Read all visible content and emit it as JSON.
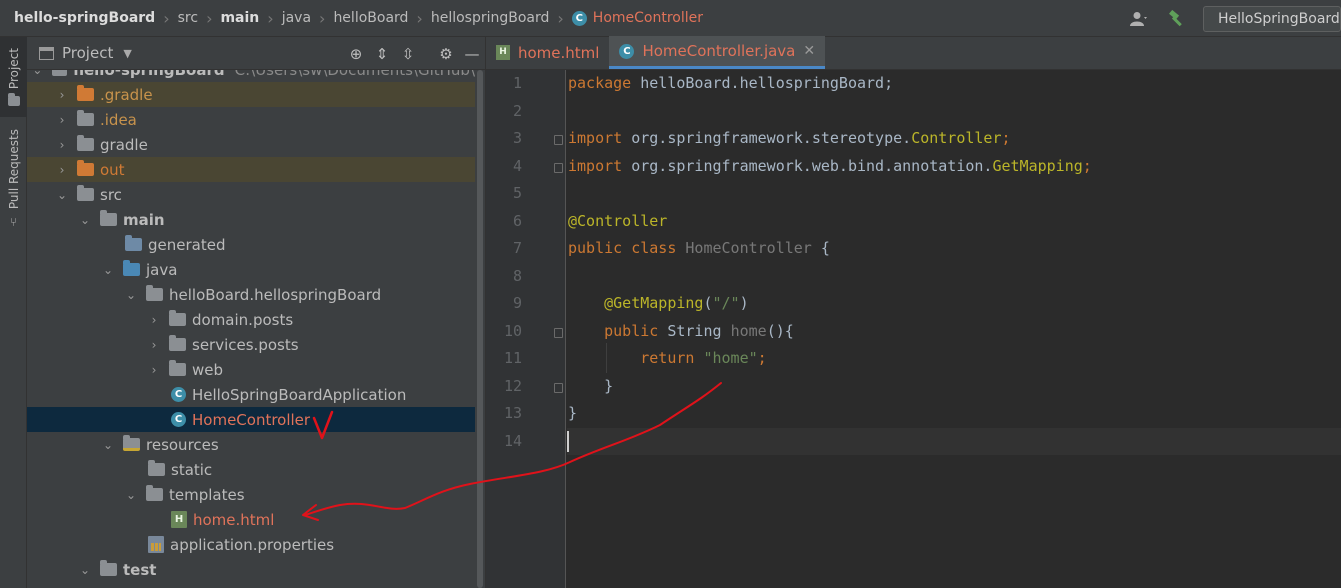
{
  "breadcrumb": [
    "hello-springBoard",
    "src",
    "main",
    "java",
    "helloBoard",
    "hellospringBoard",
    "HomeController"
  ],
  "toolbar": {
    "run_config": "HelloSpringBoardApp",
    "user_icon": "user-icon",
    "build_icon": "hammer-icon"
  },
  "tool_strip": {
    "project_tab": "Project",
    "pull_requests_tab": "Pull Requests"
  },
  "project_panel": {
    "title": "Project",
    "root": {
      "label": "hello-springBoard",
      "path": "C:\\Users\\sw\\Documents\\GitHub\\"
    },
    "tree": [
      {
        "label": ".gradle",
        "kind": "folder-excluded"
      },
      {
        "label": ".idea",
        "kind": "folder"
      },
      {
        "label": "gradle",
        "kind": "folder"
      },
      {
        "label": "out",
        "kind": "folder-excluded"
      },
      {
        "label": "src",
        "kind": "folder"
      },
      {
        "label": "main",
        "kind": "folder"
      },
      {
        "label": "generated",
        "kind": "folder"
      },
      {
        "label": "java",
        "kind": "folder"
      },
      {
        "label": "helloBoard.hellospringBoard",
        "kind": "package"
      },
      {
        "label": "domain.posts",
        "kind": "package"
      },
      {
        "label": "services.posts",
        "kind": "package"
      },
      {
        "label": "web",
        "kind": "package"
      },
      {
        "label": "HelloSpringBoardApplication",
        "kind": "class"
      },
      {
        "label": "HomeController",
        "kind": "class"
      },
      {
        "label": "resources",
        "kind": "folder"
      },
      {
        "label": "static",
        "kind": "folder"
      },
      {
        "label": "templates",
        "kind": "folder"
      },
      {
        "label": "home.html",
        "kind": "html"
      },
      {
        "label": "application.properties",
        "kind": "properties"
      },
      {
        "label": "test",
        "kind": "folder"
      }
    ]
  },
  "editor": {
    "tabs": [
      {
        "label": "home.html",
        "active": false
      },
      {
        "label": "HomeController.java",
        "active": true
      }
    ],
    "line_numbers": [
      "1",
      "2",
      "3",
      "4",
      "5",
      "6",
      "7",
      "8",
      "9",
      "10",
      "11",
      "12",
      "13",
      "14"
    ],
    "code": {
      "l1_kw": "package ",
      "l1_rest": "helloBoard.hellospringBoard;",
      "l3_kw": "import ",
      "l3_pkg": "org.springframework.stereotype.",
      "l3_cls": "Controller",
      "l3_end": ";",
      "l4_kw": "import ",
      "l4_pkg": "org.springframework.web.bind.annotation.",
      "l4_cls": "GetMapping",
      "l4_end": ";",
      "l6_ann": "@Controller",
      "l7_kw": "public class ",
      "l7_cls": "HomeController",
      "l7_rest": " {",
      "l9_ann": "@GetMapping",
      "l9_open": "(",
      "l9_str": "\"/\"",
      "l9_close": ")",
      "l10_kw": "public ",
      "l10_type": "String ",
      "l10_method": "home",
      "l10_rest": "(){",
      "l11_kw": "return ",
      "l11_str": "\"home\"",
      "l11_end": ";",
      "l12": "}",
      "l13": "}"
    }
  },
  "colors": {
    "annotation_pen": "#e0121a",
    "accent_blue": "#4a88c7",
    "modified_file": "#e0735a"
  }
}
